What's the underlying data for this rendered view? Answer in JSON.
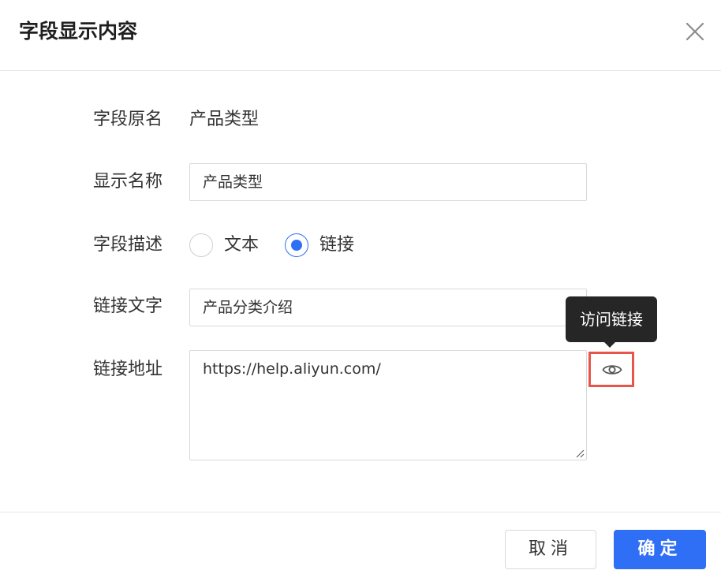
{
  "dialog": {
    "title": "字段显示内容"
  },
  "form": {
    "original_name": {
      "label": "字段原名",
      "value": "产品类型"
    },
    "display_name": {
      "label": "显示名称",
      "value": "产品类型"
    },
    "description": {
      "label": "字段描述",
      "options": [
        {
          "label": "文本",
          "checked": false
        },
        {
          "label": "链接",
          "checked": true
        }
      ]
    },
    "link_text": {
      "label": "链接文字",
      "value": "产品分类介绍"
    },
    "link_url": {
      "label": "链接地址",
      "value": "https://help.aliyun.com/"
    }
  },
  "tooltip": {
    "text": "访问链接"
  },
  "icons": {
    "close": "close-icon",
    "preview": "eye-icon"
  },
  "colors": {
    "primary": "#2f6ff5",
    "highlight_border": "#e8564b",
    "tooltip_bg": "#262626"
  },
  "footer": {
    "cancel_label": "取消",
    "ok_label": "确定"
  }
}
